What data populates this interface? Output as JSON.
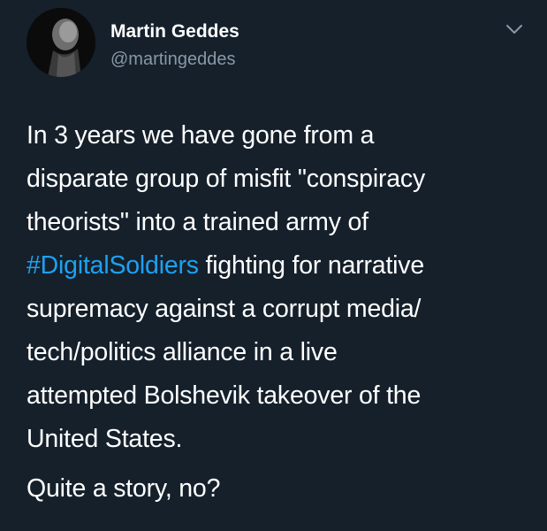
{
  "author": {
    "name": "Martin Geddes",
    "handle": "@martingeddes",
    "avatar_icon": "profile-photo"
  },
  "menu": {
    "icon": "chevron-down-icon"
  },
  "tweet": {
    "lines": [
      "In 3 years we have gone from a",
      "disparate group of misfit \"conspiracy",
      "theorists\" into a trained army of",
      {
        "hashtag": "#DigitalSoldiers",
        "rest": " fighting for narrative"
      },
      "supremacy against a corrupt media/",
      "tech/politics alliance in a live",
      "attempted Bolshevik takeover of the",
      "United States."
    ],
    "closing": "Quite a story, no?"
  },
  "colors": {
    "background": "#15202b",
    "text": "#ffffff",
    "secondary_text": "#8899a6",
    "link": "#1da1f2"
  }
}
